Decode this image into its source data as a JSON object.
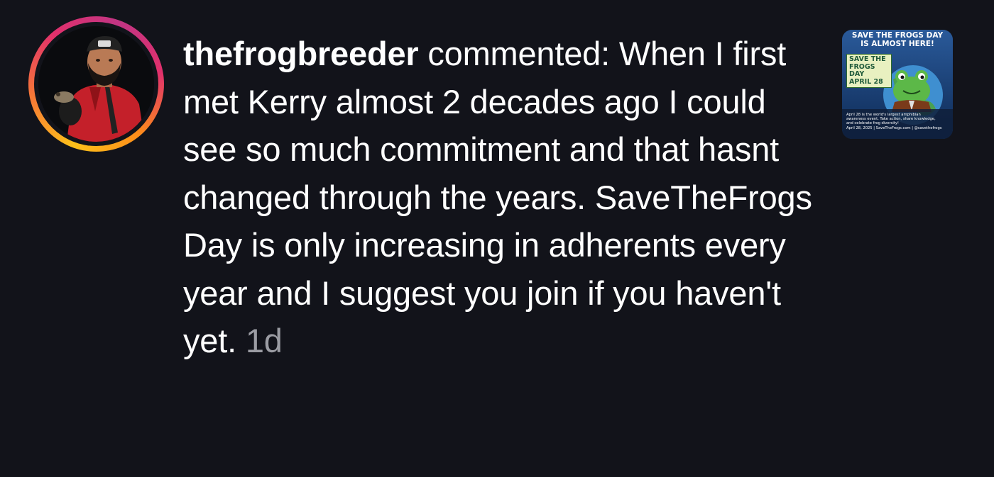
{
  "comment": {
    "username": "thefrogbreeder",
    "action": "commented:",
    "text": "When I first met Kerry almost 2 decades ago I could see so much commitment and that hasnt changed through the years. SaveTheFrogs Day is only increasing in adherents every year and I suggest you join if you haven't yet.",
    "timestamp": "1d"
  },
  "avatar": {
    "icon": "profile-photo-person-holding-frog"
  },
  "thumbnail": {
    "banner_line1": "SAVE THE FROGS DAY",
    "banner_line2": "IS ALMOST HERE!",
    "badge_line1": "SAVE THE",
    "badge_line2": "FROGS DAY",
    "badge_line3": "APRIL 28",
    "small_line1": "April 28 is the world's largest amphibian",
    "small_line2": "awareness event. Take action, share knowledge,",
    "small_line3": "and celebrate frog diversity!",
    "footer": "April 28, 2025 | SaveTheFrogs.com | @savethefrogs"
  },
  "colors": {
    "background": "#12131a",
    "text": "#ffffff",
    "timestamp": "#9b9ca3",
    "ring_gradient": [
      "#fdc11a",
      "#f77737",
      "#e1306c",
      "#c13584"
    ]
  }
}
